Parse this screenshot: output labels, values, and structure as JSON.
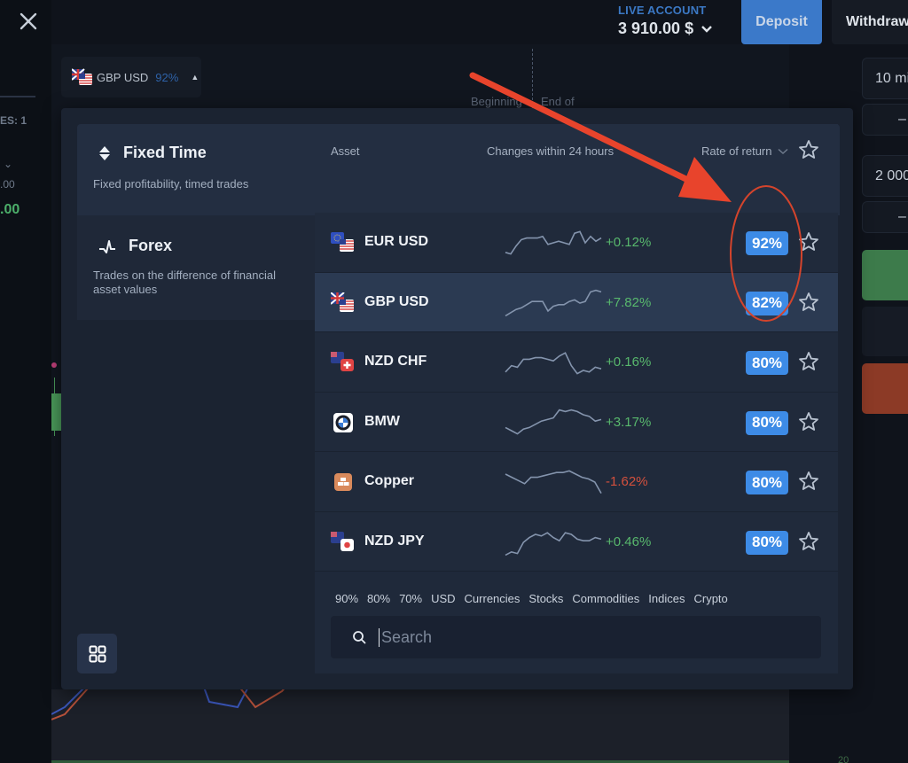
{
  "header": {
    "account_label": "LIVE ACCOUNT",
    "balance": "3 910.00 $",
    "deposit_label": "Deposit",
    "withdraw_label": "Withdraw"
  },
  "left_rail": {
    "trades_label": "ES: 1",
    "value_1": ".00",
    "value_2": ".00"
  },
  "chart": {
    "beginning_label": "Beginning",
    "end_label": "End of",
    "tick_label": "20"
  },
  "right_panel": {
    "time_value": "10 mi",
    "minus_1": "–",
    "amount_value": "2 000",
    "minus_2": "–"
  },
  "asset_pill": {
    "name": "GBP USD",
    "rate": "92%"
  },
  "categories": [
    {
      "title": "Fixed Time",
      "description": "Fixed profitability, timed trades",
      "icon": "up-down-arrows-icon",
      "active": true
    },
    {
      "title": "Forex",
      "description": "Trades on the difference of financial asset values",
      "icon": "pulse-icon",
      "active": false
    }
  ],
  "list": {
    "headers": {
      "asset": "Asset",
      "change": "Changes within 24 hours",
      "rate": "Rate of return"
    },
    "rows": [
      {
        "name": "EUR USD",
        "change": "+0.12%",
        "direction": "up",
        "rate": "92%",
        "icon": "eur-usd-flag-icon",
        "selected": false
      },
      {
        "name": "GBP USD",
        "change": "+7.82%",
        "direction": "up",
        "rate": "82%",
        "icon": "gbp-usd-flag-icon",
        "selected": true
      },
      {
        "name": "NZD CHF",
        "change": "+0.16%",
        "direction": "up",
        "rate": "80%",
        "icon": "nzd-chf-flag-icon",
        "selected": false
      },
      {
        "name": "BMW",
        "change": "+3.17%",
        "direction": "up",
        "rate": "80%",
        "icon": "bmw-logo-icon",
        "selected": false
      },
      {
        "name": "Copper",
        "change": "-1.62%",
        "direction": "down",
        "rate": "80%",
        "icon": "copper-bars-icon",
        "selected": false
      },
      {
        "name": "NZD JPY",
        "change": "+0.46%",
        "direction": "up",
        "rate": "80%",
        "icon": "nzd-jpy-flag-icon",
        "selected": false
      }
    ],
    "sparklines": [
      [
        4,
        3,
        8,
        12,
        13,
        13,
        13,
        14,
        9,
        10,
        11,
        10,
        9,
        16,
        17,
        10,
        14,
        11,
        13
      ],
      [
        2,
        4,
        6,
        7,
        9,
        11,
        11,
        11,
        5,
        8,
        9,
        9,
        11,
        12,
        10,
        11,
        17,
        18,
        17
      ],
      [
        4,
        8,
        7,
        12,
        12,
        13,
        13,
        12,
        11,
        14,
        16,
        8,
        3,
        5,
        4,
        7,
        6
      ],
      [
        7,
        5,
        3,
        6,
        7,
        9,
        11,
        12,
        13,
        18,
        17,
        18,
        17,
        15,
        14,
        11,
        12
      ],
      [
        15,
        13,
        11,
        9,
        13,
        13,
        14,
        15,
        16,
        16,
        17,
        15,
        13,
        12,
        10,
        3
      ],
      [
        2,
        4,
        3,
        10,
        13,
        15,
        14,
        16,
        13,
        11,
        16,
        15,
        12,
        11,
        11,
        13,
        12
      ]
    ]
  },
  "filters": [
    "90%",
    "80%",
    "70%",
    "USD",
    "Currencies",
    "Stocks",
    "Commodities",
    "Indices",
    "Crypto"
  ],
  "search": {
    "placeholder": "Search",
    "value": ""
  },
  "colors": {
    "accent_blue": "#3d8be6",
    "positive": "#58b86d",
    "negative": "#d4503d",
    "annotation_red": "#e8442c"
  }
}
